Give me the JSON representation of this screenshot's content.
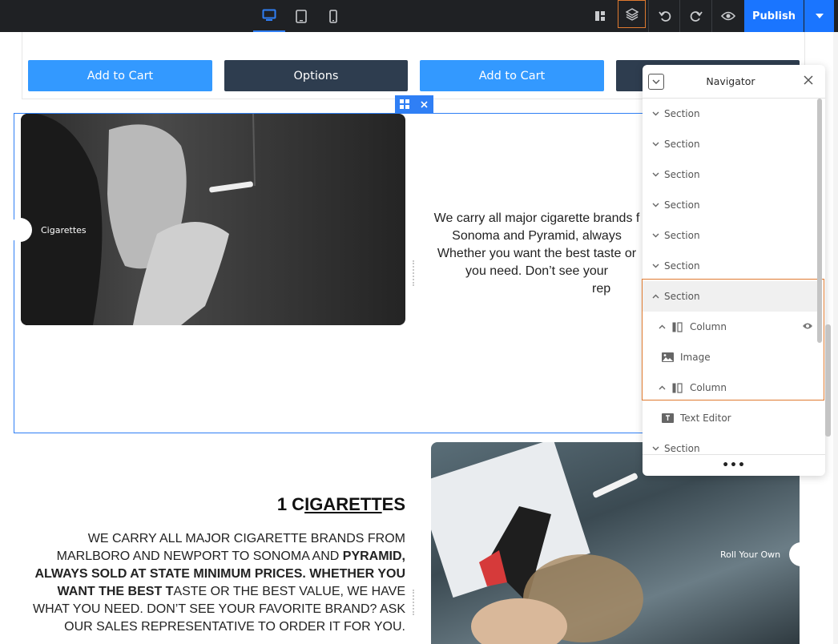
{
  "topbar": {
    "devices": [
      {
        "name": "desktop-icon",
        "active": true
      },
      {
        "name": "tablet-icon",
        "active": false
      },
      {
        "name": "mobile-icon",
        "active": false
      }
    ],
    "publish_label": "Publish",
    "accent": "#1a75ff"
  },
  "buttons": {
    "add_to_cart_1": "Add to Cart",
    "options": "Options",
    "add_to_cart_2": "Add to Cart"
  },
  "section1": {
    "image_caption": "Cigarettes",
    "paragraph_lines": [
      "We carry all major cigarette brands f",
      "Sonoma and Pyramid, always",
      "Whether you want the best taste or",
      "you need. Don’t see your",
      "rep"
    ]
  },
  "section2": {
    "heading_prefix": "1 C",
    "heading_underlined": "IGARETT",
    "heading_suffix": "ES",
    "image_caption": "Roll Your Own",
    "para_normal_1": "WE CARRY ALL MAJOR CIGARETTE BRANDS FROM MARLBORO AND NEWPORT TO SONOMA AND ",
    "para_bold": "PYRAMID, ALWAYS SOLD AT STATE MINIMUM PRICES. WHETHER YOU WANT THE BEST T",
    "para_normal_2": "ASTE OR THE BEST VALUE, WE HAVE WHAT YOU NEED. DON’T SEE YOUR FAVORITE BRAND? ASK OUR SALES REPRESENTATIVE TO ORDER IT FOR YOU."
  },
  "navigator": {
    "title": "Navigator",
    "items": [
      {
        "label": "Section",
        "type": "section",
        "expanded": false
      },
      {
        "label": "Section",
        "type": "section",
        "expanded": false
      },
      {
        "label": "Section",
        "type": "section",
        "expanded": false
      },
      {
        "label": "Section",
        "type": "section",
        "expanded": false
      },
      {
        "label": "Section",
        "type": "section",
        "expanded": false
      },
      {
        "label": "Section",
        "type": "section",
        "expanded": false
      },
      {
        "label": "Section",
        "type": "section",
        "expanded": true,
        "highlighted": true
      },
      {
        "label": "Column",
        "type": "column",
        "expanded": true,
        "eye": true
      },
      {
        "label": "Image",
        "type": "image"
      },
      {
        "label": "Column",
        "type": "column",
        "expanded": true
      },
      {
        "label": "Text Editor",
        "type": "text"
      },
      {
        "label": "Section",
        "type": "section",
        "expanded": false
      }
    ],
    "more_label": "•••",
    "selection_color": "#e07a2f"
  }
}
